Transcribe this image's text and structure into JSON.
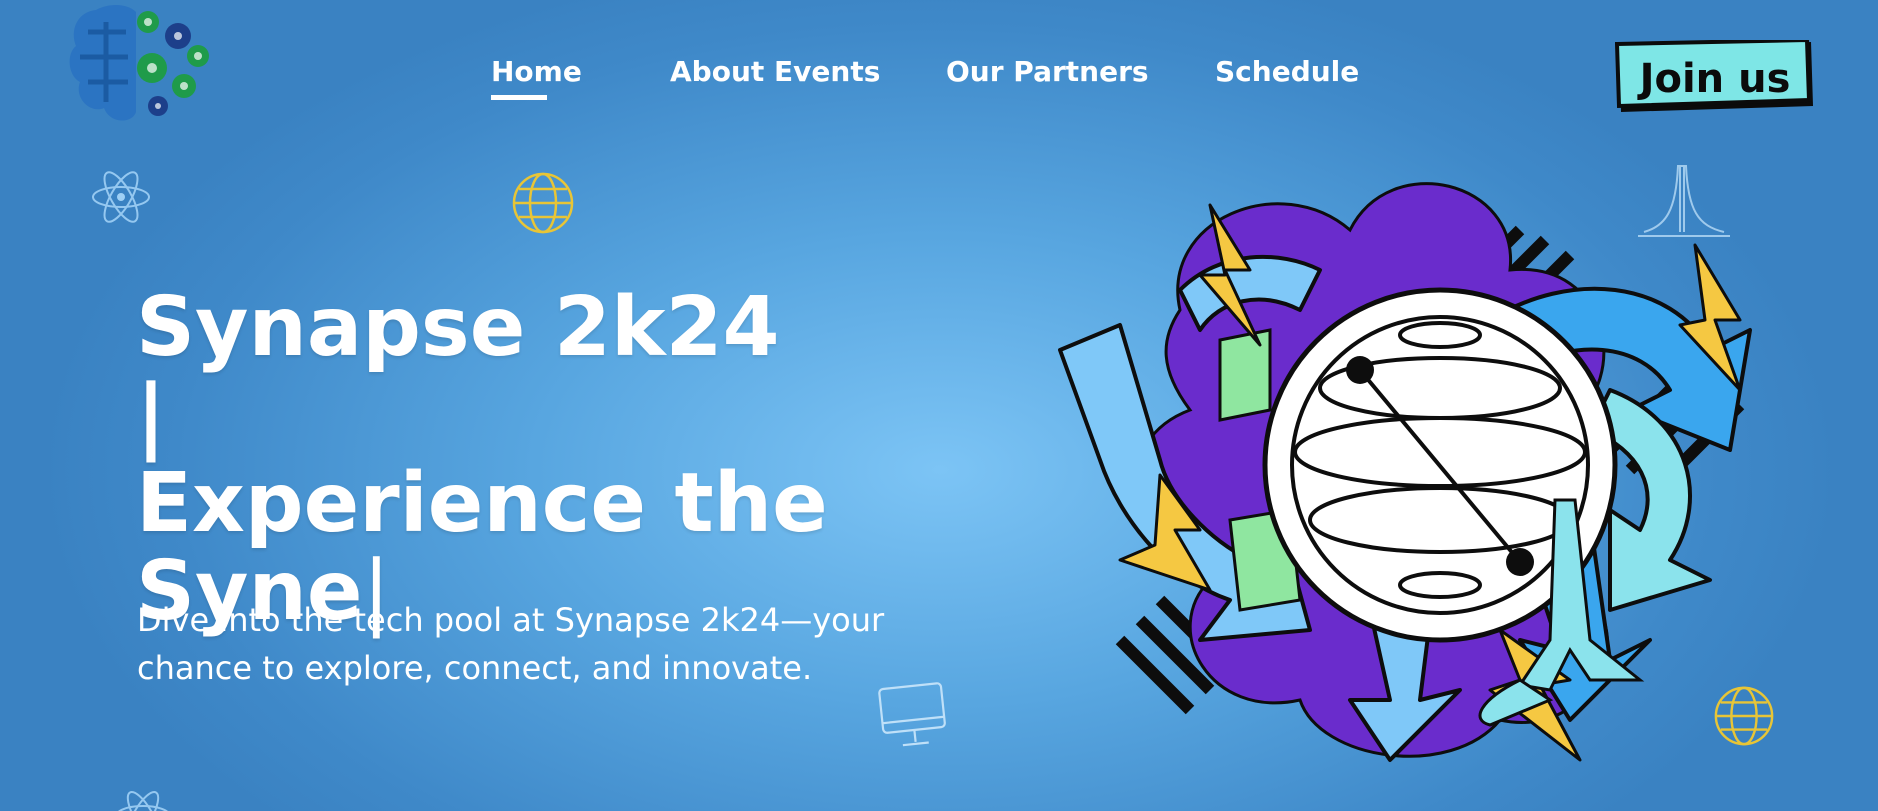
{
  "brand": {
    "logo_icon": "brain-gears-logo"
  },
  "nav": {
    "items": [
      {
        "label": "Home",
        "active": true
      },
      {
        "label": "About Events",
        "active": false
      },
      {
        "label": "Our Partners",
        "active": false
      },
      {
        "label": "Schedule",
        "active": false
      }
    ]
  },
  "cta": {
    "join_label": "Join us"
  },
  "hero": {
    "title_line1": "Synapse 2k24 |",
    "title_line2": "Experience the",
    "title_line3_text": "Syne",
    "title_cursor": "|",
    "subtitle_line1": "Dive into the tech pool at Synapse 2k24—your",
    "subtitle_line2": "chance to explore, connect, and innovate."
  },
  "decorations": {
    "icons": [
      "atom-icon",
      "globe-icon",
      "computer-monitor-icon",
      "tower-icon",
      "globe-icon",
      "atom-icon"
    ],
    "illustration": "globe-lightning-illustration"
  },
  "colors": {
    "background": "#4a95d3",
    "cta_fill": "#7ee6e6",
    "purple": "#6a2ccc",
    "lightning": "#f5c842",
    "arrow_blue": "#7fc8f8",
    "mint": "#8fe6a0"
  }
}
